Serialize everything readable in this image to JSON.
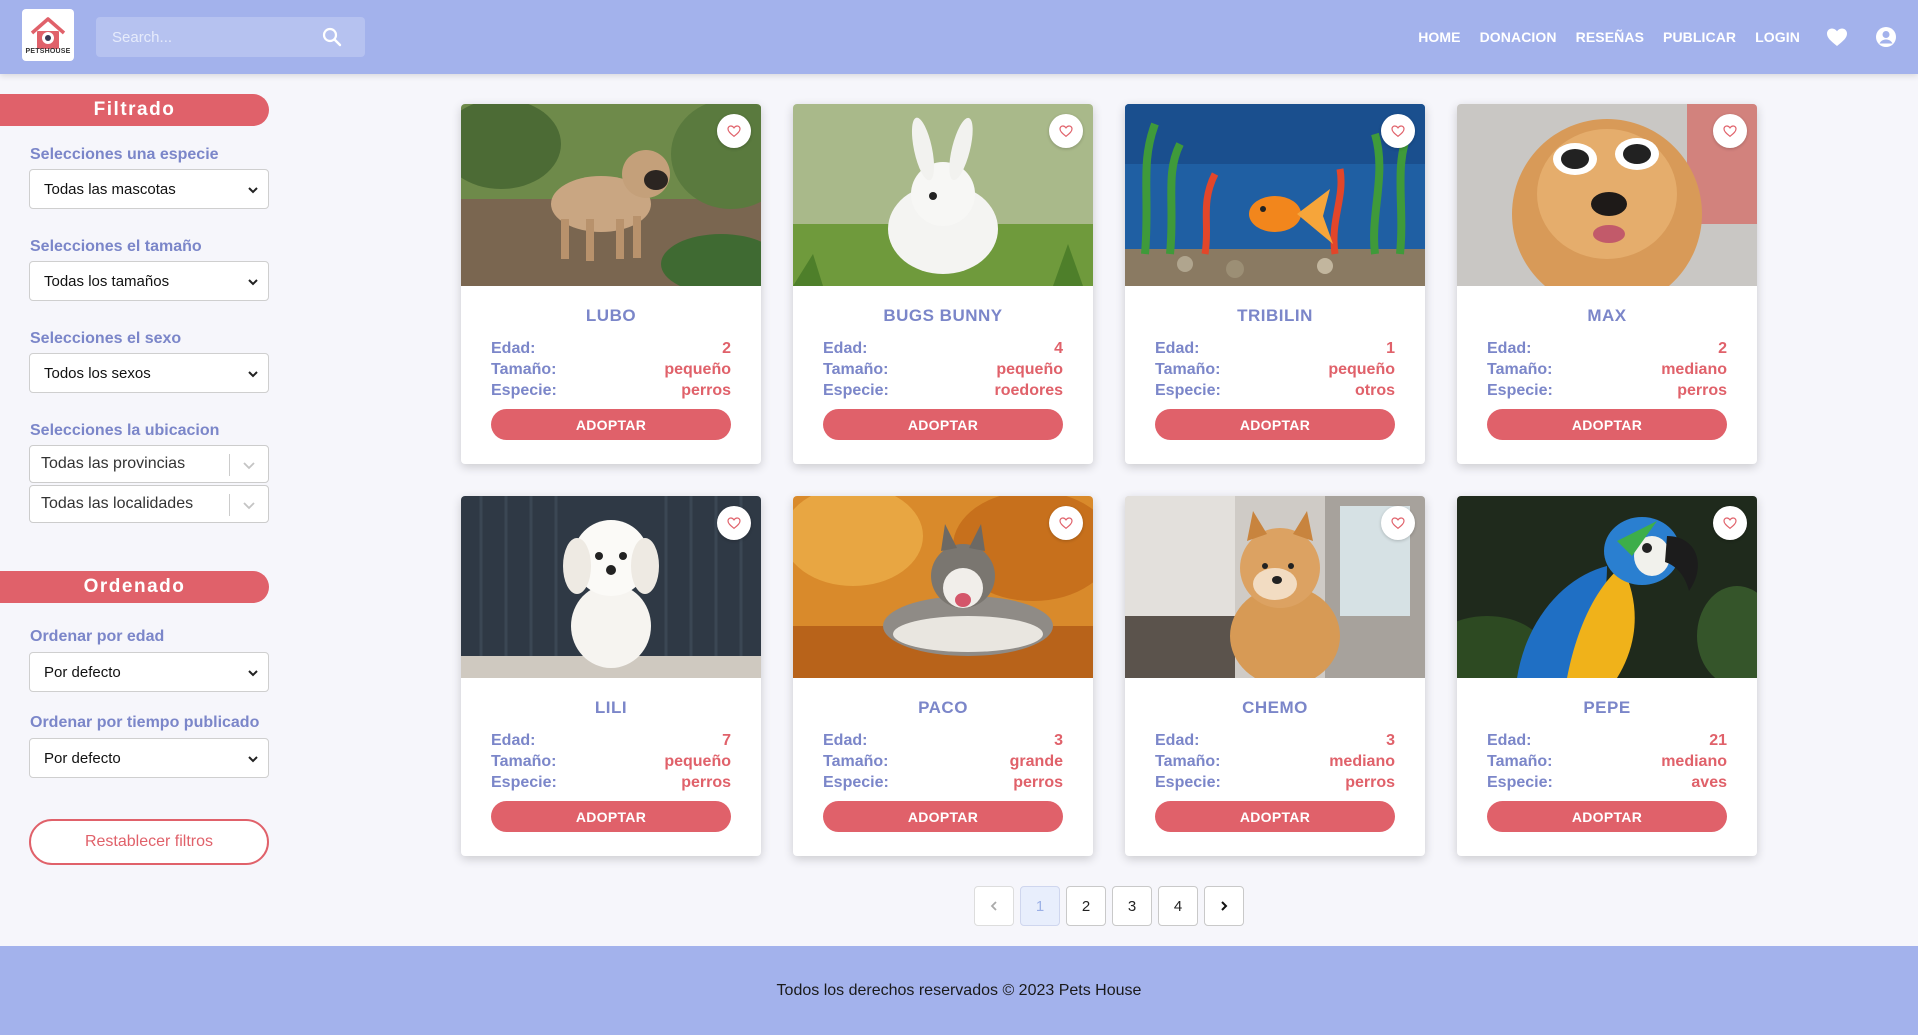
{
  "header": {
    "logo_text": "PETSHOUSE",
    "search_placeholder": "Search...",
    "nav": [
      "HOME",
      "DONACION",
      "RESEÑAS",
      "PUBLICAR",
      "LOGIN"
    ],
    "icons": [
      "heart-icon",
      "user-account-icon"
    ]
  },
  "sidebar": {
    "filter_title": "Filtrado",
    "species_label": "Selecciones una especie",
    "species_value": "Todas las mascotas",
    "size_label": "Selecciones el tamaño",
    "size_value": "Todas los tamaños",
    "sex_label": "Selecciones el sexo",
    "sex_value": "Todos los sexos",
    "location_label": "Selecciones la ubicacion",
    "province_value": "Todas las provincias",
    "locality_value": "Todas las localidades",
    "order_title": "Ordenado",
    "age_order_label": "Ordenar por edad",
    "age_order_value": "Por defecto",
    "time_order_label": "Ordenar por tiempo publicado",
    "time_order_value": "Por defecto",
    "reset_label": "Restablecer filtros"
  },
  "card_labels": {
    "age": "Edad:",
    "size": "Tamaño:",
    "species": "Especie:",
    "adopt": "ADOPTAR"
  },
  "pets": [
    {
      "name": "LUBO",
      "age": "2",
      "size": "pequeño",
      "species": "perros"
    },
    {
      "name": "BUGS BUNNY",
      "age": "4",
      "size": "pequeño",
      "species": "roedores"
    },
    {
      "name": "TRIBILIN",
      "age": "1",
      "size": "pequeño",
      "species": "otros"
    },
    {
      "name": "MAX",
      "age": "2",
      "size": "mediano",
      "species": "perros"
    },
    {
      "name": "LILI",
      "age": "7",
      "size": "pequeño",
      "species": "perros"
    },
    {
      "name": "PACO",
      "age": "3",
      "size": "grande",
      "species": "perros"
    },
    {
      "name": "CHEMO",
      "age": "3",
      "size": "mediano",
      "species": "perros"
    },
    {
      "name": "PEPE",
      "age": "21",
      "size": "mediano",
      "species": "aves"
    }
  ],
  "pagination": {
    "pages": [
      "1",
      "2",
      "3",
      "4"
    ],
    "current": "1"
  },
  "footer": {
    "text": "Todos los derechos reservados © 2023 Pets House"
  },
  "colors": {
    "primary": "#a3b2ec",
    "accent": "#e0616a",
    "label": "#7b86c9"
  }
}
